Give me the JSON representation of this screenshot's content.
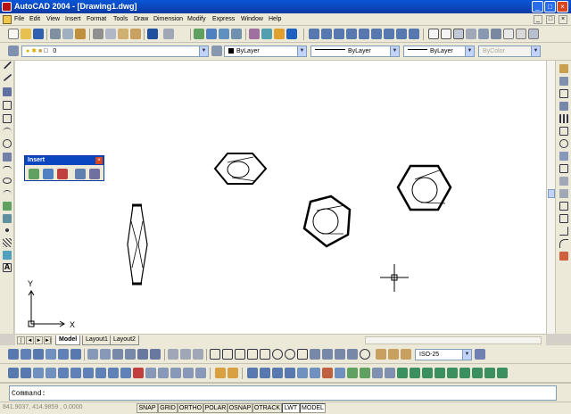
{
  "window": {
    "title": "AutoCAD 2004 - [Drawing1.dwg]",
    "minimize": "_",
    "maximize": "□",
    "close": "×"
  },
  "menu": [
    "File",
    "Edit",
    "View",
    "Insert",
    "Format",
    "Tools",
    "Draw",
    "Dimension",
    "Modify",
    "Express",
    "Window",
    "Help"
  ],
  "mdi_controls": [
    "_",
    "□",
    "×"
  ],
  "layers": {
    "current_layer": "0"
  },
  "properties": {
    "color": "ByLayer",
    "linetype": "ByLayer",
    "lineweight": "ByLayer",
    "plotstyle": "ByColor"
  },
  "dim_style": "ISO-25",
  "insert_toolbar": {
    "title": "Insert",
    "close": "×"
  },
  "ucs": {
    "x_label": "X",
    "y_label": "Y"
  },
  "tabs": [
    {
      "label": "Model",
      "active": true
    },
    {
      "label": "Layout1"
    },
    {
      "label": "Layout2"
    }
  ],
  "tab_nav": [
    "|◄",
    "◄",
    "►",
    "►|"
  ],
  "command": {
    "prompt": "Command:"
  },
  "status": {
    "coordinates": "841.9037, 414.9859 , 0.0000",
    "toggles": [
      {
        "label": "SNAP",
        "on": false
      },
      {
        "label": "GRID",
        "on": false
      },
      {
        "label": "ORTHO",
        "on": false
      },
      {
        "label": "POLAR",
        "on": false
      },
      {
        "label": "OSNAP",
        "on": false
      },
      {
        "label": "OTRACK",
        "on": false
      },
      {
        "label": "LWT",
        "on": true
      },
      {
        "label": "MODEL",
        "on": true
      }
    ]
  },
  "colors": {
    "title_blue": "#0a46c0",
    "toolbar_bg": "#ece9d8",
    "canvas_bg": "#ffffff",
    "drawing_stroke": "#000000"
  }
}
